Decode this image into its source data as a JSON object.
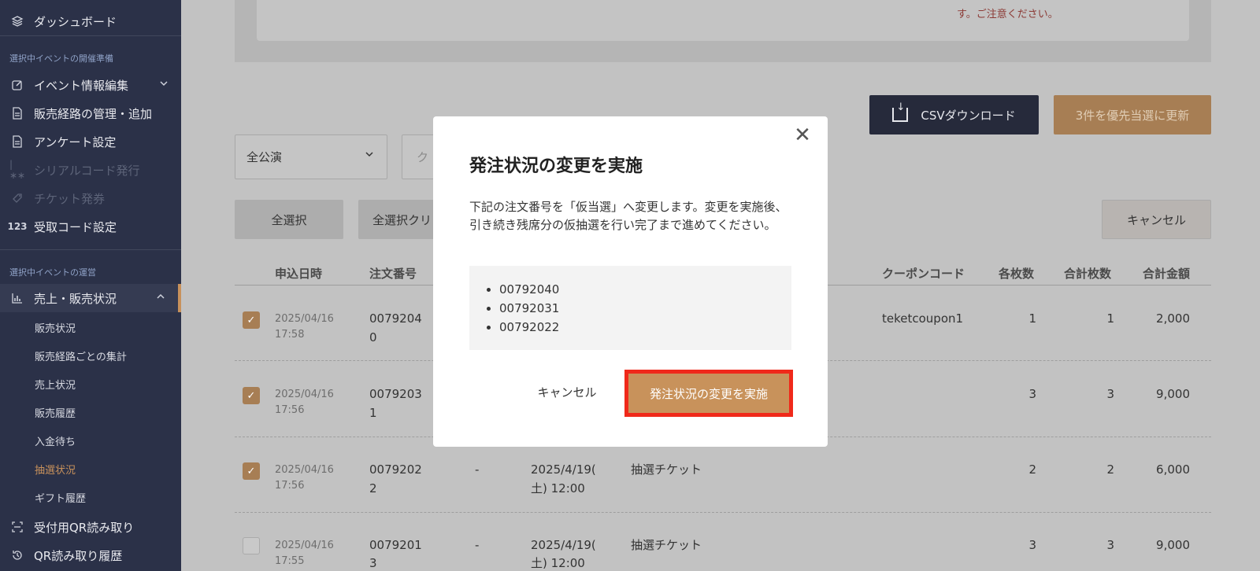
{
  "sidebar": {
    "items": [
      {
        "label": "ダッシュボード",
        "icon": "layers-icon"
      },
      {
        "label": "イベント情報編集",
        "icon": "edit-icon"
      },
      {
        "label": "販売経路の管理・追加",
        "icon": "document-icon"
      },
      {
        "label": "アンケート設定",
        "icon": "document-icon"
      },
      {
        "label": "シリアルコード発行",
        "icon": "serial-code-icon"
      },
      {
        "label": "チケット発券",
        "icon": "ticket-icon"
      },
      {
        "label": "受取コード設定",
        "icon": "123"
      },
      {
        "label": "売上・販売状況",
        "icon": "bar-chart-icon"
      },
      {
        "label": "受付用QR読み取り",
        "icon": "qr-scan-icon"
      },
      {
        "label": "QR読み取り履歴",
        "icon": "history-icon"
      }
    ],
    "sections": [
      "選択中イベントの開催準備",
      "選択中イベントの運営"
    ],
    "sub_items": [
      "販売状況",
      "販売経路ごとの集計",
      "売上状況",
      "販売履歴",
      "入金待ち",
      "抽選状況",
      "ギフト履歴"
    ]
  },
  "main": {
    "warning_text": "す。ご注意ください。",
    "csv_button": "CSVダウンロード",
    "update_button": "3件を優先当選に更新",
    "performance_select": "全公演",
    "coupon_placeholder": "ク",
    "select_all": "全選択",
    "clear_all": "全選択クリ",
    "cancel": "キャンセル",
    "columns": [
      "申込日時",
      "注文番号",
      "クーポンコード",
      "各枚数",
      "合計枚数",
      "合計金額"
    ],
    "rows": [
      {
        "date": "2025/04/16",
        "time": "17:58",
        "order_a": "0079204",
        "order_b": "0",
        "dash": "",
        "perf_a": "",
        "perf_b": "",
        "ticket": "",
        "coupon": "teketcoupon1",
        "each": "1",
        "total_qty": "1",
        "amount": "2,000",
        "checked": true
      },
      {
        "date": "2025/04/16",
        "time": "17:56",
        "order_a": "0079203",
        "order_b": "1",
        "dash": "",
        "perf_a": "",
        "perf_b": "",
        "ticket": "",
        "coupon": "",
        "each": "3",
        "total_qty": "3",
        "amount": "9,000",
        "checked": true
      },
      {
        "date": "2025/04/16",
        "time": "17:56",
        "order_a": "0079202",
        "order_b": "2",
        "dash": "-",
        "perf_a": "2025/4/19(",
        "perf_b": "土) 12:00",
        "ticket": "抽選チケット",
        "coupon": "",
        "each": "2",
        "total_qty": "2",
        "amount": "6,000",
        "checked": true
      },
      {
        "date": "2025/04/16",
        "time": "17:55",
        "order_a": "0079201",
        "order_b": "3",
        "dash": "-",
        "perf_a": "2025/4/19(",
        "perf_b": "土) 12:00",
        "ticket": "抽選チケット",
        "coupon": "",
        "each": "3",
        "total_qty": "3",
        "amount": "9,000",
        "checked": false
      }
    ]
  },
  "modal": {
    "title": "発注状況の変更を実施",
    "description": "下記の注文番号を「仮当選」へ変更します。変更を実施後、引き続き残席分の仮抽選を行い完了まで進めてください。",
    "orders": [
      "00792040",
      "00792031",
      "00792022"
    ],
    "cancel_label": "キャンセル",
    "confirm_label": "発注状況の変更を実施",
    "close_symbol": "✕"
  }
}
